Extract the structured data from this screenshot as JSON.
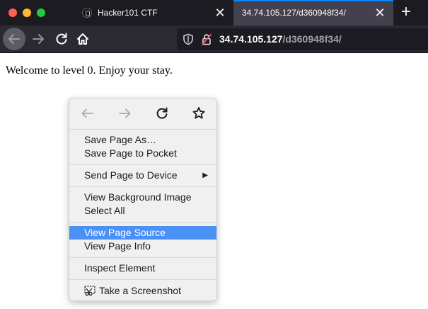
{
  "tabs": [
    {
      "title": "Hacker101 CTF",
      "active": false,
      "close": "✕"
    },
    {
      "title": "34.74.105.127/d360948f34/",
      "active": true,
      "close": "✕"
    }
  ],
  "new_tab_symbol": "+",
  "urlbar": {
    "host": "34.74.105.127",
    "path": "/d360948f34/"
  },
  "page": {
    "text": "Welcome to level 0. Enjoy your stay."
  },
  "context_menu": {
    "groups": [
      [
        "Save Page As…",
        "Save Page to Pocket"
      ],
      [
        "Send Page to Device"
      ],
      [
        "View Background Image",
        "Select All"
      ],
      [
        "View Page Source",
        "View Page Info"
      ],
      [
        "Inspect Element"
      ],
      [
        "Take a Screenshot"
      ]
    ],
    "highlighted": "View Page Source",
    "submenu_arrow": "▶"
  },
  "colors": {
    "accent": "#0a84ff",
    "highlight": "#4a90f5",
    "tabstrip": "#1c1b22",
    "toolbar": "#2b2a33"
  },
  "icons": [
    "back-icon",
    "forward-icon",
    "reload-icon",
    "home-icon",
    "shield-icon",
    "insecure-lock-icon",
    "bookmark-star-icon",
    "screenshot-icon"
  ]
}
